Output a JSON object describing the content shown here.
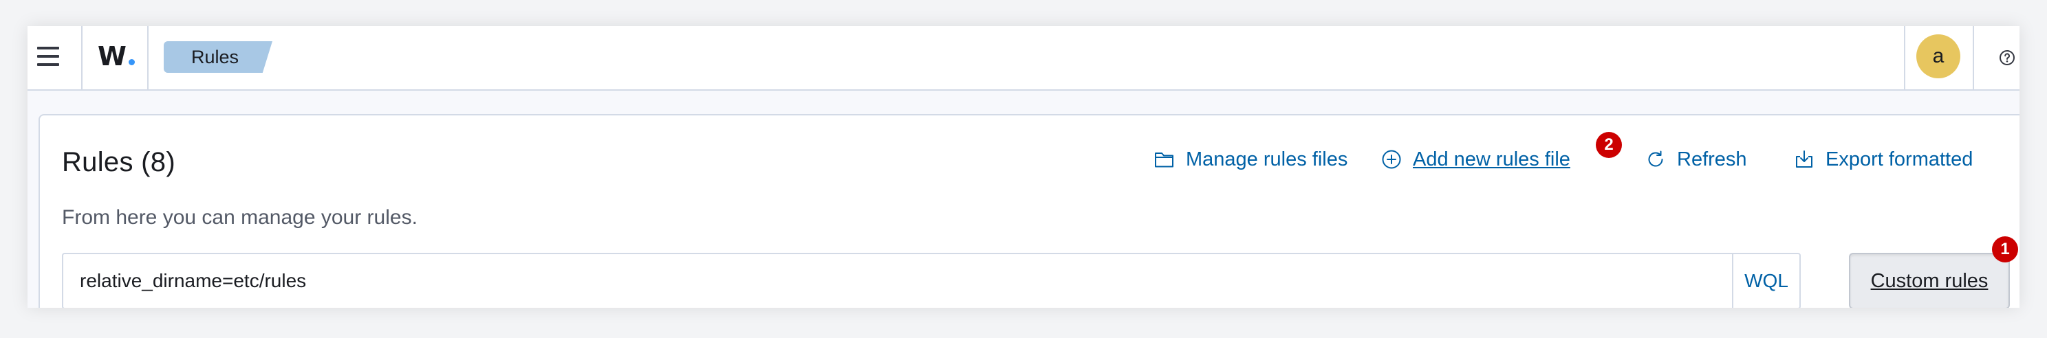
{
  "header": {
    "logo_text": "W.",
    "logo_letter": "W",
    "breadcrumb": "Rules",
    "avatar_letter": "a"
  },
  "panel": {
    "title": "Rules (8)",
    "description": "From here you can manage your rules.",
    "actions": [
      {
        "label": "Manage rules files",
        "icon": "folder-icon"
      },
      {
        "label": "Add new rules file",
        "icon": "plus-circle-icon",
        "badge": "2"
      },
      {
        "label": "Refresh",
        "icon": "refresh-icon"
      },
      {
        "label": "Export formatted",
        "icon": "export-icon"
      }
    ],
    "search": {
      "value": "relative_dirname=etc/rules",
      "language": "WQL"
    },
    "custom_rules_button": {
      "label": "Custom rules",
      "badge": "1"
    }
  },
  "colors": {
    "link": "#0061a6",
    "breadcrumb_bg": "#a8c8e5",
    "avatar_bg": "#e7c65f",
    "badge_bg": "#cc0000",
    "logo_dot": "#3595f9"
  }
}
